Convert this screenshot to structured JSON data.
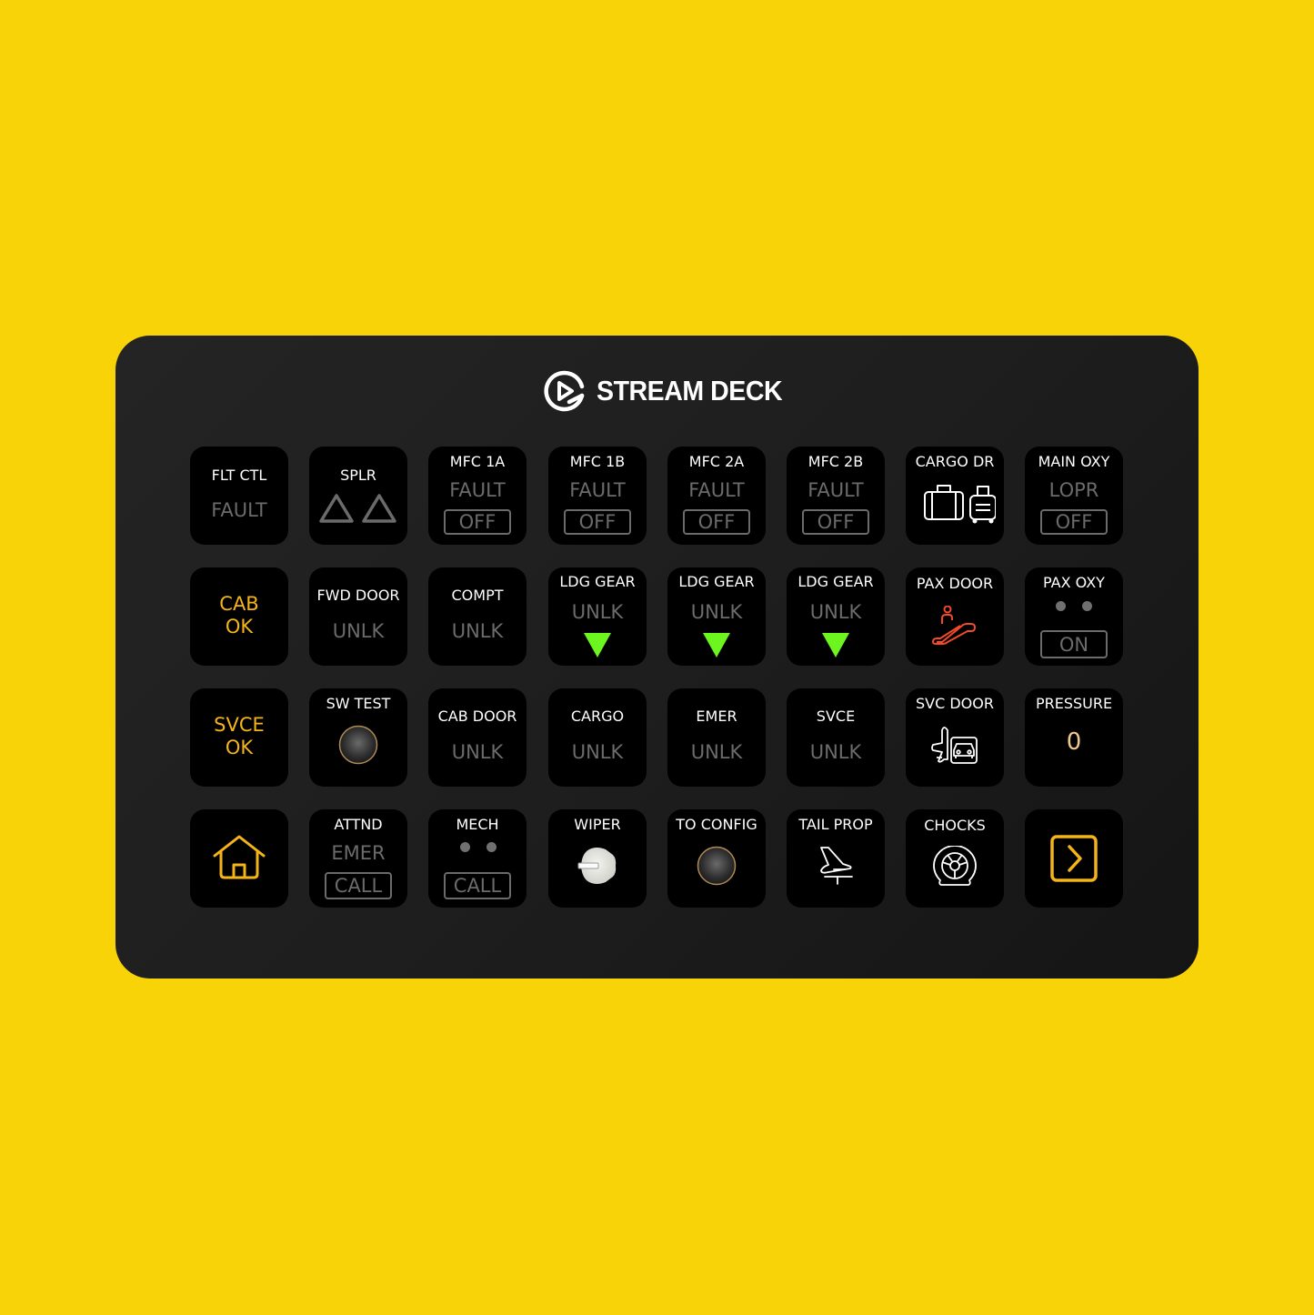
{
  "colors": {
    "background": "#f7d307",
    "panel": "#1e1e1e",
    "key": "#000000",
    "label": "#ffffff",
    "dim_status": "#6b6b6b",
    "amber": "#f5b417",
    "gear_green": "#6cf51e",
    "escalator_red": "#f24a2a",
    "pressure_value": "#f2c98a"
  },
  "device": {
    "brand": "STREAM DECK",
    "logo_icon": "elgato-logo-icon"
  },
  "keys": {
    "flt_ctl": {
      "title": "FLT CTL",
      "status": "FAULT"
    },
    "splr": {
      "title": "SPLR",
      "icon": "triangle-outline-icon"
    },
    "mfc_1a": {
      "title": "MFC 1A",
      "status": "FAULT",
      "button": "OFF"
    },
    "mfc_1b": {
      "title": "MFC 1B",
      "status": "FAULT",
      "button": "OFF"
    },
    "mfc_2a": {
      "title": "MFC 2A",
      "status": "FAULT",
      "button": "OFF"
    },
    "mfc_2b": {
      "title": "MFC 2B",
      "status": "FAULT",
      "button": "OFF"
    },
    "cargo_dr": {
      "title": "CARGO DR",
      "icon": "luggage-icon"
    },
    "main_oxy": {
      "title": "MAIN OXY",
      "status": "LOPR",
      "button": "OFF"
    },
    "cab_ok": {
      "line1": "CAB",
      "line2": "OK"
    },
    "fwd_door": {
      "title": "FWD DOOR",
      "status": "UNLK"
    },
    "compt": {
      "title": "COMPT",
      "status": "UNLK"
    },
    "ldg_gear_1": {
      "title": "LDG GEAR",
      "status": "UNLK",
      "icon": "gear-down-arrow-icon"
    },
    "ldg_gear_2": {
      "title": "LDG GEAR",
      "status": "UNLK",
      "icon": "gear-down-arrow-icon"
    },
    "ldg_gear_3": {
      "title": "LDG GEAR",
      "status": "UNLK",
      "icon": "gear-down-arrow-icon"
    },
    "pax_door": {
      "title": "PAX DOOR",
      "icon": "escalator-icon"
    },
    "pax_oxy": {
      "title": "PAX OXY",
      "button": "ON"
    },
    "svce_ok": {
      "line1": "SVCE",
      "line2": "OK"
    },
    "sw_test": {
      "title": "SW TEST",
      "icon": "push-button-icon"
    },
    "cab_door": {
      "title": "CAB DOOR",
      "status": "UNLK"
    },
    "cargo": {
      "title": "CARGO",
      "status": "UNLK"
    },
    "emer": {
      "title": "EMER",
      "status": "UNLK"
    },
    "svce": {
      "title": "SVCE",
      "status": "UNLK"
    },
    "svc_door": {
      "title": "SVC DOOR",
      "icon": "plane-truck-icon"
    },
    "pressure": {
      "title": "PRESSURE",
      "value": "0"
    },
    "home": {
      "icon": "home-icon"
    },
    "attnd": {
      "title": "ATTND",
      "status": "EMER",
      "button": "CALL"
    },
    "mech": {
      "title": "MECH",
      "button": "CALL"
    },
    "wiper": {
      "title": "WIPER",
      "icon": "rotary-knob-icon"
    },
    "to_config": {
      "title": "TO CONFIG",
      "icon": "push-button-icon"
    },
    "tail_prop": {
      "title": "TAIL PROP",
      "icon": "tail-icon"
    },
    "chocks": {
      "title": "CHOCKS",
      "icon": "wheel-chock-icon"
    },
    "next_page": {
      "icon": "chevron-right-box-icon"
    }
  }
}
